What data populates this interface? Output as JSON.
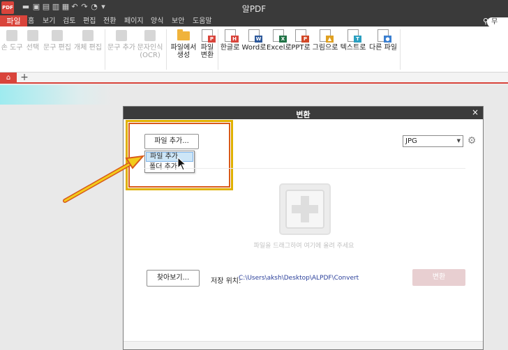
{
  "titlebar": {
    "title": "알PDF",
    "logo": "PDF"
  },
  "menubar": {
    "file": "파일",
    "items": [
      "홈",
      "보기",
      "검토",
      "편집",
      "전환",
      "페이지",
      "양식",
      "보안",
      "도움말"
    ]
  },
  "search": {
    "value": "무"
  },
  "ribbon": {
    "hand_tool": "손 도구",
    "select": "선택",
    "text_edit": "문구 편집",
    "object_edit": "개체 편집",
    "add_text": "문구 추가",
    "ocr_line1": "문자인식",
    "ocr_line2": "(OCR)",
    "create_from_file_line1": "파일에서",
    "create_from_file_line2": "생성",
    "convert_file_line1": "파일",
    "convert_file_line2": "변환",
    "to_hwp": "한글로",
    "to_word": "Word로",
    "to_excel": "Excel로",
    "to_ppt": "PPT로",
    "to_image": "그림으로",
    "to_text": "텍스트로",
    "other_file": "다른 파일"
  },
  "tabs": {
    "add": "+"
  },
  "dialog": {
    "title": "변환",
    "close": "×",
    "add_file_button": "파일 추가...",
    "menu_add_file": "파일 추가",
    "menu_add_folder": "폴더 추가",
    "format_selected": "JPG",
    "drop_hint": "파일을 드래그하여 여기에 올려 주세요",
    "browse_button": "찾아보기...",
    "save_location_label": "저장 위치:",
    "save_location_path": "C:\\Users\\aksh\\Desktop\\ALPDF\\Convert",
    "convert_button": "변환"
  },
  "colors": {
    "accent": "#d9443b",
    "title_bg": "#3a3a3a",
    "highlight_yellow": "#e0b000",
    "highlight_orange": "#d95a1a"
  }
}
